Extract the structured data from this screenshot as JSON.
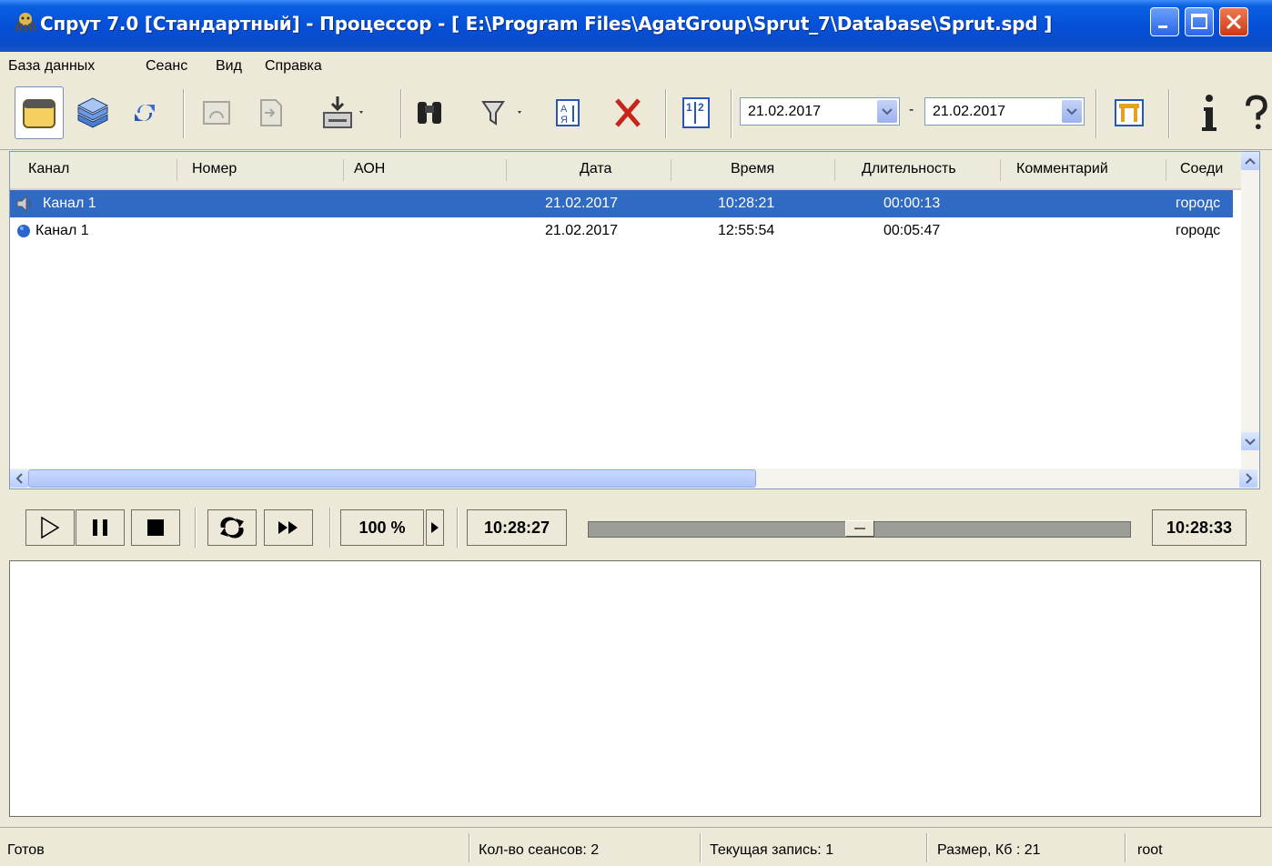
{
  "window": {
    "title": "Спрут 7.0 [Стандартный] - Процессор - [ E:\\Program Files\\AgatGroup\\Sprut_7\\Database\\Sprut.spd ]"
  },
  "menu": [
    "База данных",
    "Сеанс",
    "Вид",
    "Справка"
  ],
  "toolbar": {
    "date_from": "21.02.2017",
    "date_separator": "-",
    "date_to": "21.02.2017",
    "icons": [
      "database-icon",
      "sessions-stack-icon",
      "refresh-icon",
      "listen-icon",
      "export-icon",
      "download-icon",
      "find-icon",
      "filter-icon",
      "sort-icon",
      "delete-icon",
      "numbering-icon",
      "settings-icon",
      "info-icon",
      "help-icon"
    ]
  },
  "grid": {
    "columns": [
      "Канал",
      "Номер",
      "АОН",
      "Дата",
      "Время",
      "Длительность",
      "Комментарий",
      "Соеди"
    ],
    "rows": [
      {
        "channel": "Канал 1",
        "date": "21.02.2017",
        "time": "10:28:21",
        "duration": "00:00:13",
        "connection": "городс",
        "selected": true,
        "icon": "speaker-icon"
      },
      {
        "channel": "Канал 1",
        "date": "21.02.2017",
        "time": "12:55:54",
        "duration": "00:05:47",
        "connection": "городс",
        "selected": false,
        "icon": "blue-dot-icon"
      }
    ]
  },
  "player": {
    "speed": "100 %",
    "time_start": "10:28:27",
    "time_end": "10:28:33",
    "position": 0.5
  },
  "status": {
    "state": "Готов",
    "sessions": "Кол-во сеансов: 2",
    "current": "Текущая запись: 1",
    "size": "Размер, Кб : 21",
    "user": "root"
  },
  "colors": {
    "selection": "#316ac5",
    "titlebar": "#0550d8",
    "face": "#ece9d8"
  }
}
